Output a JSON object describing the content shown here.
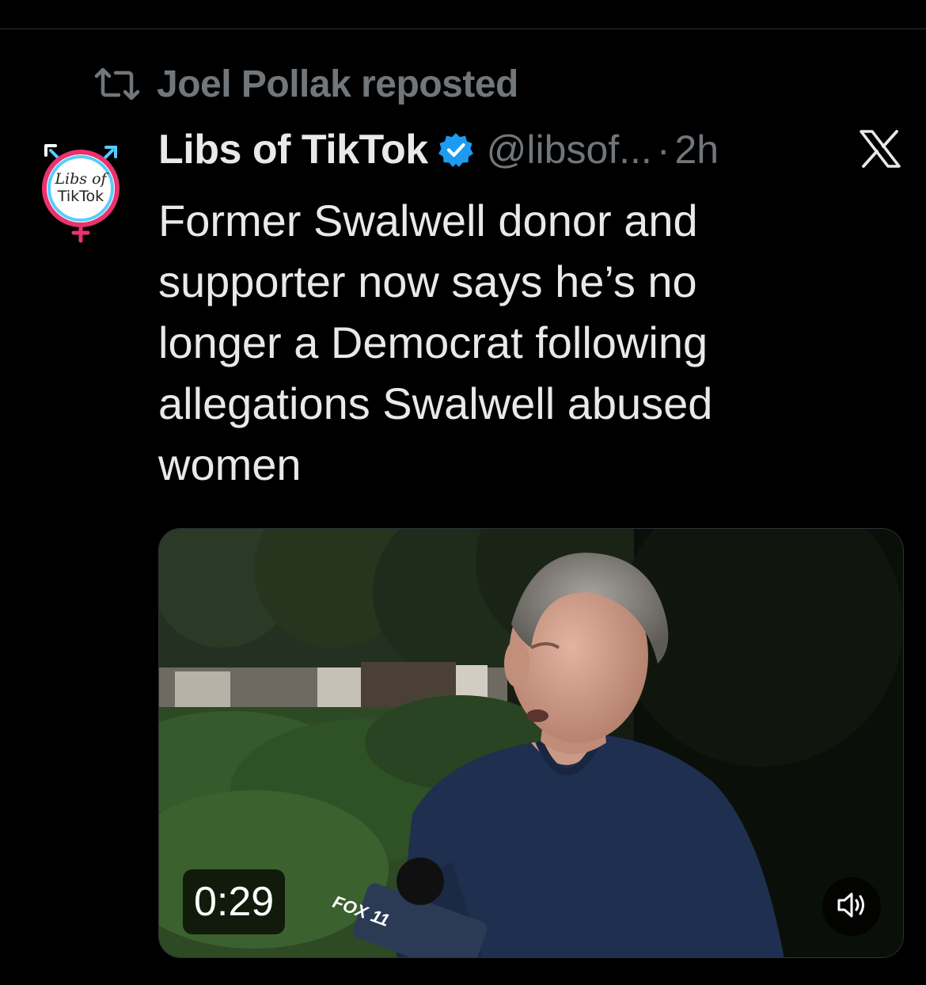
{
  "repost": {
    "text": "Joel Pollak reposted",
    "icon": "repost-icon"
  },
  "tweet": {
    "avatar": {
      "lines": [
        "Libs of",
        "TikTok"
      ]
    },
    "author_name": "Libs of TikTok",
    "verified_icon": "verified-badge-icon",
    "handle": "@libsof...",
    "separator": "·",
    "time": "2h",
    "platform_icon": "x-logo-icon",
    "text": "Former Swalwell donor and\nsupporter now says he’s no\nlonger a Democrat following\nallegations Swalwell abused\nwomen",
    "media": {
      "type": "video",
      "duration": "0:29",
      "mic_flag_text": "FOX 11",
      "volume_icon": "volume-muted-icon"
    }
  },
  "colors": {
    "background": "#000000",
    "primary_text": "#e7e9ea",
    "secondary_text": "#71767b",
    "verified_blue": "#1d9bf0",
    "divider": "#2f3336"
  }
}
